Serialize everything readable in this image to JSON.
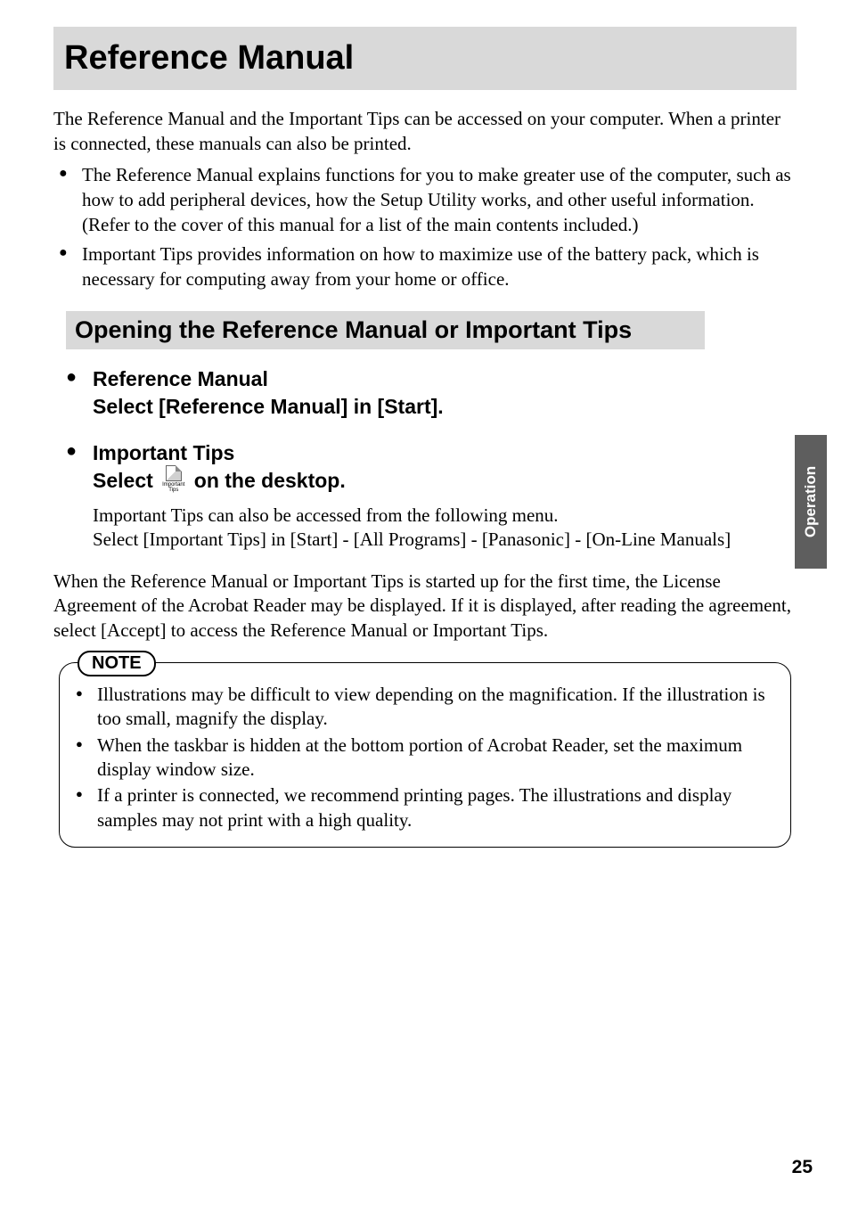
{
  "title": "Reference Manual",
  "intro": "The Reference Manual and the Important Tips can be accessed on your computer. When a printer is connected, these manuals can also be printed.",
  "bullets": [
    "The Reference Manual explains functions for you to make greater use of the computer, such as how to add peripheral devices, how the Setup Utility works, and other useful information. (Refer to the cover of this manual for a list of the main contents included.)",
    "Important Tips provides information on how to maximize use of the battery pack, which is necessary for computing away from your home or office."
  ],
  "section_heading": "Opening the Reference Manual or Important Tips",
  "ref_manual": {
    "title": "Reference Manual",
    "instruction": "Select [Reference Manual] in [Start]."
  },
  "important_tips": {
    "title": "Important Tips",
    "instruction_prefix": "Select ",
    "instruction_suffix": " on the desktop.",
    "icon_label": "Important Tips",
    "body_line1": "Important Tips can also be accessed from the following menu.",
    "body_line2": "Select [Important Tips] in [Start] - [All Programs] - [Panasonic] - [On-Line Manuals]"
  },
  "agreement": "When the Reference Manual or Important Tips is started up for the first time, the License Agreement of the Acrobat Reader may be displayed. If it is displayed, after reading the agreement, select [Accept] to access the Reference Manual or Important Tips.",
  "note": {
    "label": "NOTE",
    "items": [
      "Illustrations may be difficult to view depending on the magnification.  If the illustration is too small, magnify the display.",
      "When the taskbar is hidden at the bottom portion of Acrobat Reader, set the maximum display window size.",
      "If a printer is connected, we recommend printing pages.  The illustrations and display samples may not print with a high quality."
    ]
  },
  "side_tab": "Operation",
  "page_number": "25"
}
